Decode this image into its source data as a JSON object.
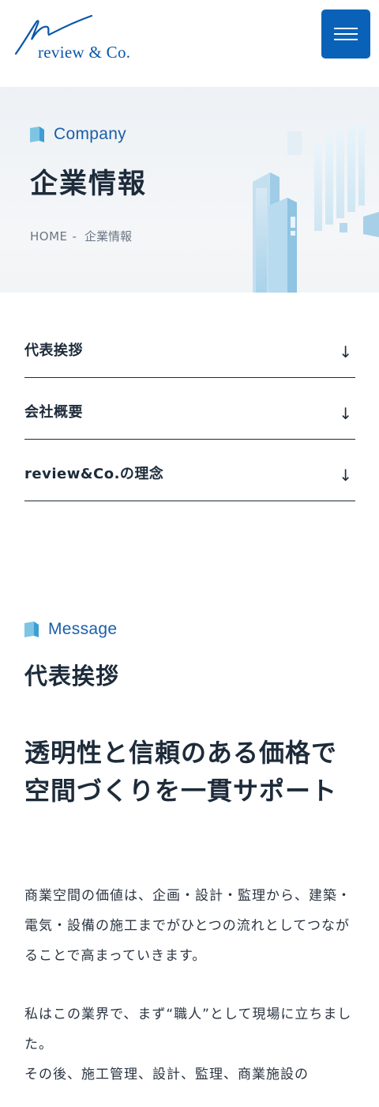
{
  "header": {
    "logo_text": "review & Co.",
    "menu_button_label": "Menu"
  },
  "hero": {
    "eyebrow": "Company",
    "title": "企業情報",
    "breadcrumb": {
      "home": "HOME",
      "separator": "-",
      "current": "企業情報"
    }
  },
  "anchors": [
    {
      "label": "代表挨拶",
      "arrow": "↓"
    },
    {
      "label": "会社概要",
      "arrow": "↓"
    },
    {
      "label": "review&Co.の理念",
      "arrow": "↓"
    }
  ],
  "message": {
    "eyebrow": "Message",
    "heading": "代表挨拶",
    "lead": "透明性と信頼のある価格で空間づくりを一貫サポート",
    "paragraphs": [
      "商業空間の価値は、企画・設計・監理から、建築・電気・設備の施工までがひとつの流れとしてつながることで高まっていきます。",
      "私はこの業界で、まず“職人”として現場に立ちました。\nその後、施工管理、設計、監理、商業施設の"
    ]
  },
  "colors": {
    "accent": "#0a62b8",
    "text_dark": "#1d2b3a",
    "eyebrow": "#1a5fa9"
  },
  "icons": {
    "menu": "hamburger-icon",
    "eyebrow": "folded-square-icon",
    "anchor": "arrow-down-icon"
  }
}
